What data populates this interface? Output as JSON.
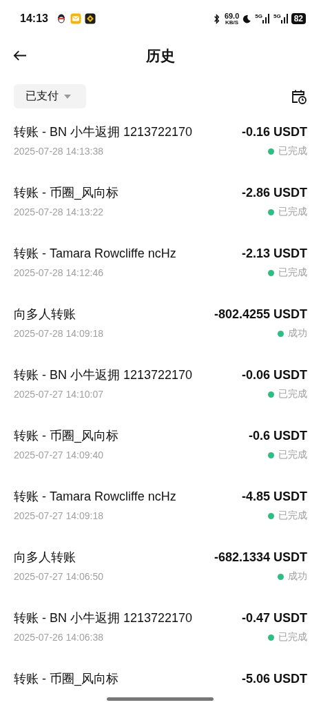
{
  "status_bar": {
    "time": "14:13",
    "speed": "69.0",
    "speed_unit": "KB/S",
    "networks": [
      "5G",
      "5G"
    ],
    "battery": "82"
  },
  "header": {
    "title": "历史"
  },
  "filter": {
    "label": "已支付"
  },
  "transactions": [
    {
      "title": "转账 - BN 小牛返拥 1213722170",
      "amount": "-0.16 USDT",
      "date": "2025-07-28 14:13:38",
      "status": "已完成"
    },
    {
      "title": "转账 - 币圈_风向标",
      "amount": "-2.86 USDT",
      "date": "2025-07-28 14:13:22",
      "status": "已完成"
    },
    {
      "title": "转账 - Tamara Rowcliffe ncHz",
      "amount": "-2.13 USDT",
      "date": "2025-07-28 14:12:46",
      "status": "已完成"
    },
    {
      "title": "向多人转账",
      "amount": "-802.4255 USDT",
      "date": "2025-07-28 14:09:18",
      "status": "成功"
    },
    {
      "title": "转账 - BN 小牛返拥 1213722170",
      "amount": "-0.06 USDT",
      "date": "2025-07-27 14:10:07",
      "status": "已完成"
    },
    {
      "title": "转账 - 币圈_风向标",
      "amount": "-0.6 USDT",
      "date": "2025-07-27 14:09:40",
      "status": "已完成"
    },
    {
      "title": "转账 - Tamara Rowcliffe ncHz",
      "amount": "-4.85 USDT",
      "date": "2025-07-27 14:09:18",
      "status": "已完成"
    },
    {
      "title": "向多人转账",
      "amount": "-682.1334 USDT",
      "date": "2025-07-27 14:06:50",
      "status": "成功"
    },
    {
      "title": "转账 - BN 小牛返拥 1213722170",
      "amount": "-0.47 USDT",
      "date": "2025-07-26 14:06:38",
      "status": "已完成"
    },
    {
      "title": "转账 - 币圈_风向标",
      "amount": "-5.06 USDT"
    }
  ]
}
